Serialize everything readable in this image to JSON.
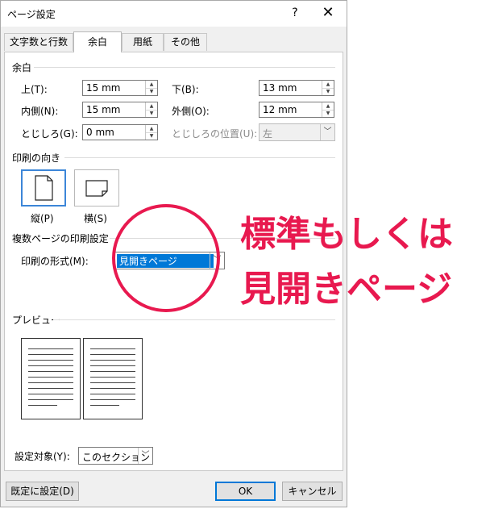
{
  "window": {
    "title": "ページ設定",
    "help_label": "?",
    "close_label": "✕"
  },
  "tabs": [
    {
      "label": "文字数と行数"
    },
    {
      "label": "余白"
    },
    {
      "label": "用紙"
    },
    {
      "label": "その他"
    }
  ],
  "margins": {
    "heading": "余白",
    "top": {
      "label": "上(T):",
      "value": "15 mm"
    },
    "bottom": {
      "label": "下(B):",
      "value": "13 mm"
    },
    "inside": {
      "label": "内側(N):",
      "value": "15 mm"
    },
    "outside": {
      "label": "外側(O):",
      "value": "12 mm"
    },
    "gutter": {
      "label": "とじしろ(G):",
      "value": "0 mm"
    },
    "gutter_position": {
      "label": "とじしろの位置(U):",
      "value": "左"
    }
  },
  "orientation": {
    "heading": "印刷の向き",
    "portrait_label": "縦(P)",
    "landscape_label": "横(S)",
    "selected": "portrait"
  },
  "multiple_pages": {
    "heading": "複数ページの印刷設定",
    "label": "印刷の形式(M):",
    "value": "見開きページ"
  },
  "preview": {
    "heading": "プレビュー"
  },
  "apply_to": {
    "label": "設定対象(Y):",
    "value": "このセクション"
  },
  "buttons": {
    "set_default": "既定に設定(D)",
    "ok": "OK",
    "cancel": "キャンセル"
  },
  "annotation": {
    "line1": "標準もしくは",
    "line2": "見開きページ",
    "color": "#e8194f"
  },
  "colors": {
    "accent": "#0078d7",
    "annotation": "#e8194f"
  }
}
